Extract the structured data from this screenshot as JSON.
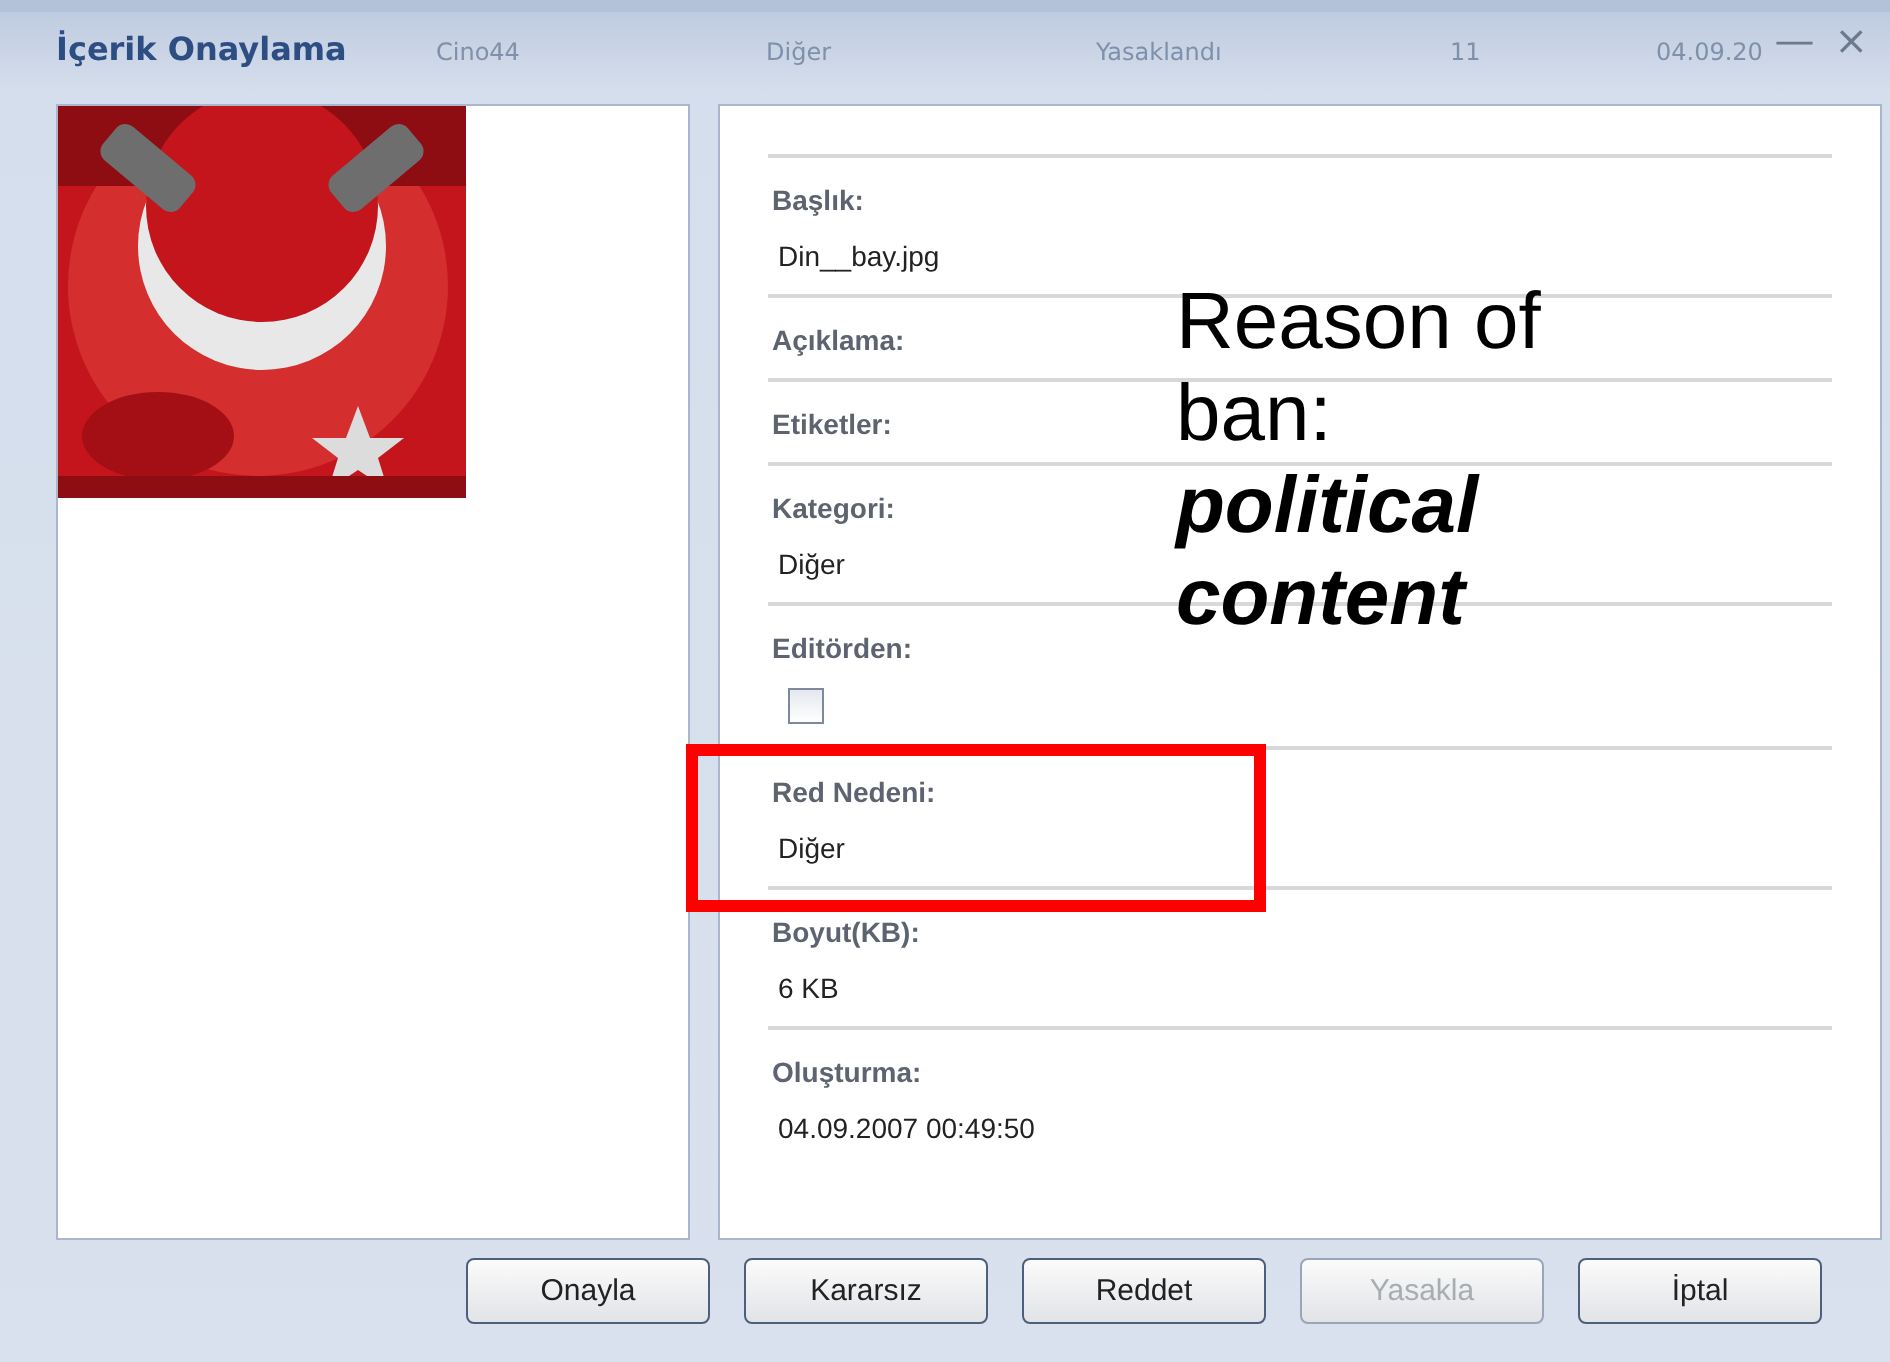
{
  "window": {
    "title": "İçerik Onaylama",
    "controls": [
      "—",
      "×"
    ]
  },
  "background_row": [
    "Cino44",
    "Diğer",
    "Yasaklandı",
    "11",
    "04.09.20"
  ],
  "fields": [
    {
      "kind": "text",
      "label": "Başlık:",
      "value": "Din__bay.jpg"
    },
    {
      "kind": "text",
      "label": "Açıklama:"
    },
    {
      "kind": "text",
      "label": "Etiketler:"
    },
    {
      "kind": "text",
      "label": "Kategori:",
      "value": "Diğer"
    },
    {
      "kind": "checkbox",
      "label": "Editörden:",
      "checked": false
    },
    {
      "kind": "text",
      "label": "Red Nedeni:",
      "value": "Diğer"
    },
    {
      "kind": "text",
      "label": "Boyut(KB):",
      "value": "6 KB"
    },
    {
      "kind": "text",
      "label": "Oluşturma:",
      "value": "04.09.2007 00:49:50"
    }
  ],
  "buttons": [
    {
      "label": "Onayla",
      "disabled": false
    },
    {
      "label": "Kararsız",
      "disabled": false
    },
    {
      "label": "Reddet",
      "disabled": false
    },
    {
      "label": "Yasakla",
      "disabled": true
    },
    {
      "label": "İptal",
      "disabled": false
    }
  ],
  "annotation": {
    "text": "Reason of ban:",
    "emphasis": "political content"
  }
}
